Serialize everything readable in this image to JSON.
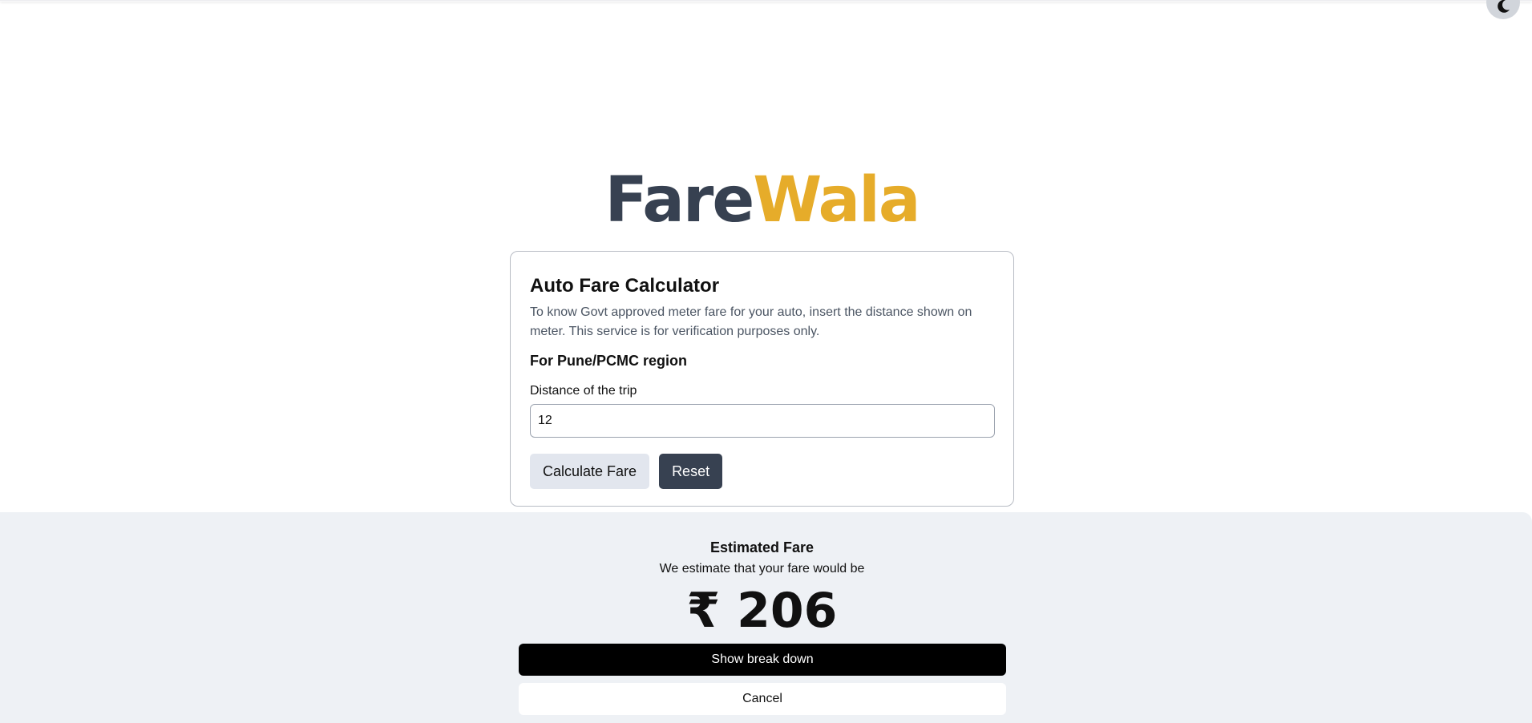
{
  "logo": {
    "part1": "Fare",
    "part2": "Wala"
  },
  "theme_toggle": {
    "icon": "moon-icon"
  },
  "calculator": {
    "title": "Auto Fare Calculator",
    "description": "To know Govt approved meter fare for your auto, insert the distance shown on meter. This service is for verification purposes only.",
    "region": "For Pune/PCMC region",
    "distance_label": "Distance of the trip",
    "distance_value": "12",
    "calculate_label": "Calculate Fare",
    "reset_label": "Reset"
  },
  "result": {
    "title": "Estimated Fare",
    "subtitle": "We estimate that your fare would be",
    "amount": "₹ 206",
    "breakdown_label": "Show break down",
    "cancel_label": "Cancel"
  },
  "colors": {
    "logo_dark": "#374151",
    "logo_accent": "#e6ac2a",
    "sheet_bg": "#eef1f5"
  }
}
